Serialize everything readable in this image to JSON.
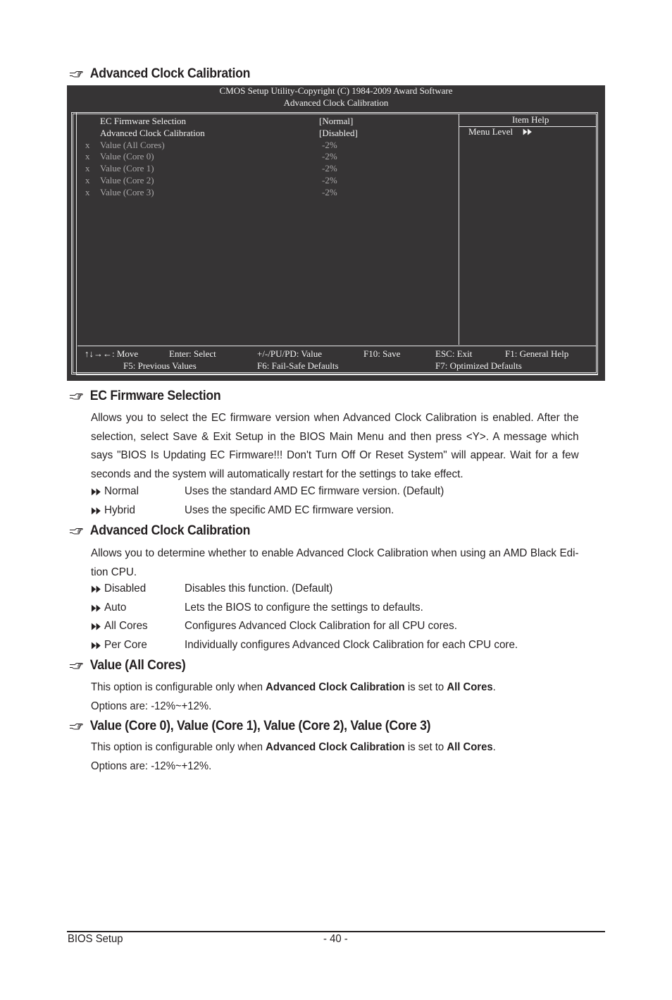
{
  "headings": {
    "main": "Advanced Clock Calibration",
    "ec_firmware": "EC Firmware Selection",
    "adv_clock": "Advanced Clock Calibration",
    "value_all": "Value (All Cores)",
    "value_cores": "Value (Core 0), Value (Core 1), Value (Core 2), Value (Core 3)"
  },
  "bios": {
    "title_line1": "CMOS Setup Utility-Copyright (C) 1984-2009 Award Software",
    "title_line2": "Advanced Clock Calibration",
    "items": [
      {
        "prefix": "",
        "label": "EC Firmware Selection",
        "value": "[Normal]",
        "disabled": false
      },
      {
        "prefix": "",
        "label": "Advanced Clock Calibration",
        "value": "[Disabled]",
        "disabled": false
      },
      {
        "prefix": "x",
        "label": "Value (All Cores)",
        "value": "-2%",
        "disabled": true
      },
      {
        "prefix": "x",
        "label": "Value (Core 0)",
        "value": "-2%",
        "disabled": true
      },
      {
        "prefix": "x",
        "label": "Value (Core 1)",
        "value": "-2%",
        "disabled": true
      },
      {
        "prefix": "x",
        "label": "Value (Core 2)",
        "value": "-2%",
        "disabled": true
      },
      {
        "prefix": "x",
        "label": "Value (Core 3)",
        "value": "-2%",
        "disabled": true
      }
    ],
    "help": {
      "title": "Item Help",
      "menu_level": "Menu Level",
      "menu_level_icon": "double-right-arrow"
    },
    "footer": {
      "move": "↑↓→←: Move",
      "enter": "Enter: Select",
      "value": "+/-/PU/PD: Value",
      "f10": "F10: Save",
      "esc": "ESC: Exit",
      "f1": "F1: General Help",
      "f5": "F5: Previous Values",
      "f6": "F6: Fail-Safe Defaults",
      "f7": "F7: Optimized Defaults"
    }
  },
  "ec_firmware": {
    "description": "Allows you to select the EC firmware version when Advanced Clock Calibration is enabled. After the selection, select Save & Exit Setup in the BIOS Main Menu and then press <Y>. A message which says \"BIOS Is Updating EC Firmware!!! Don't Turn Off Or Reset System\" will appear. Wait for a few seconds and the system will automatically restart for the settings to take effect.",
    "options": [
      {
        "name": "Normal",
        "desc": "Uses the standard AMD EC firmware version. (Default)"
      },
      {
        "name": "Hybrid",
        "desc": "Uses the specific AMD EC firmware version."
      }
    ]
  },
  "adv_clock": {
    "description": "Allows you to determine whether to enable Advanced Clock Calibration when using an AMD Black Edi-tion CPU.",
    "options": [
      {
        "name": "Disabled",
        "desc": "Disables this function. (Default)"
      },
      {
        "name": "Auto",
        "desc": "Lets the BIOS to configure the settings to defaults."
      },
      {
        "name": "All Cores",
        "desc": "Configures Advanced Clock Calibration for all CPU cores."
      },
      {
        "name": "Per Core",
        "desc": "Individually configures Advanced Clock Calibration for each CPU core."
      }
    ]
  },
  "value_all": {
    "note_pre": "This option is configurable only when ",
    "note_b1": "Advanced Clock Calibration",
    "note_mid": " is set to ",
    "note_b2": "All Cores",
    "note_end": ".",
    "options_line": "Options are: -12%~+12%."
  },
  "value_cores": {
    "note_pre": "This option is configurable only when ",
    "note_b1": "Advanced Clock Calibration",
    "note_mid": " is set to ",
    "note_b2": "All Cores",
    "note_end": ".",
    "options_line": "Options are: -12%~+12%."
  },
  "footer": {
    "left": "BIOS Setup",
    "page": "- 40 -"
  }
}
